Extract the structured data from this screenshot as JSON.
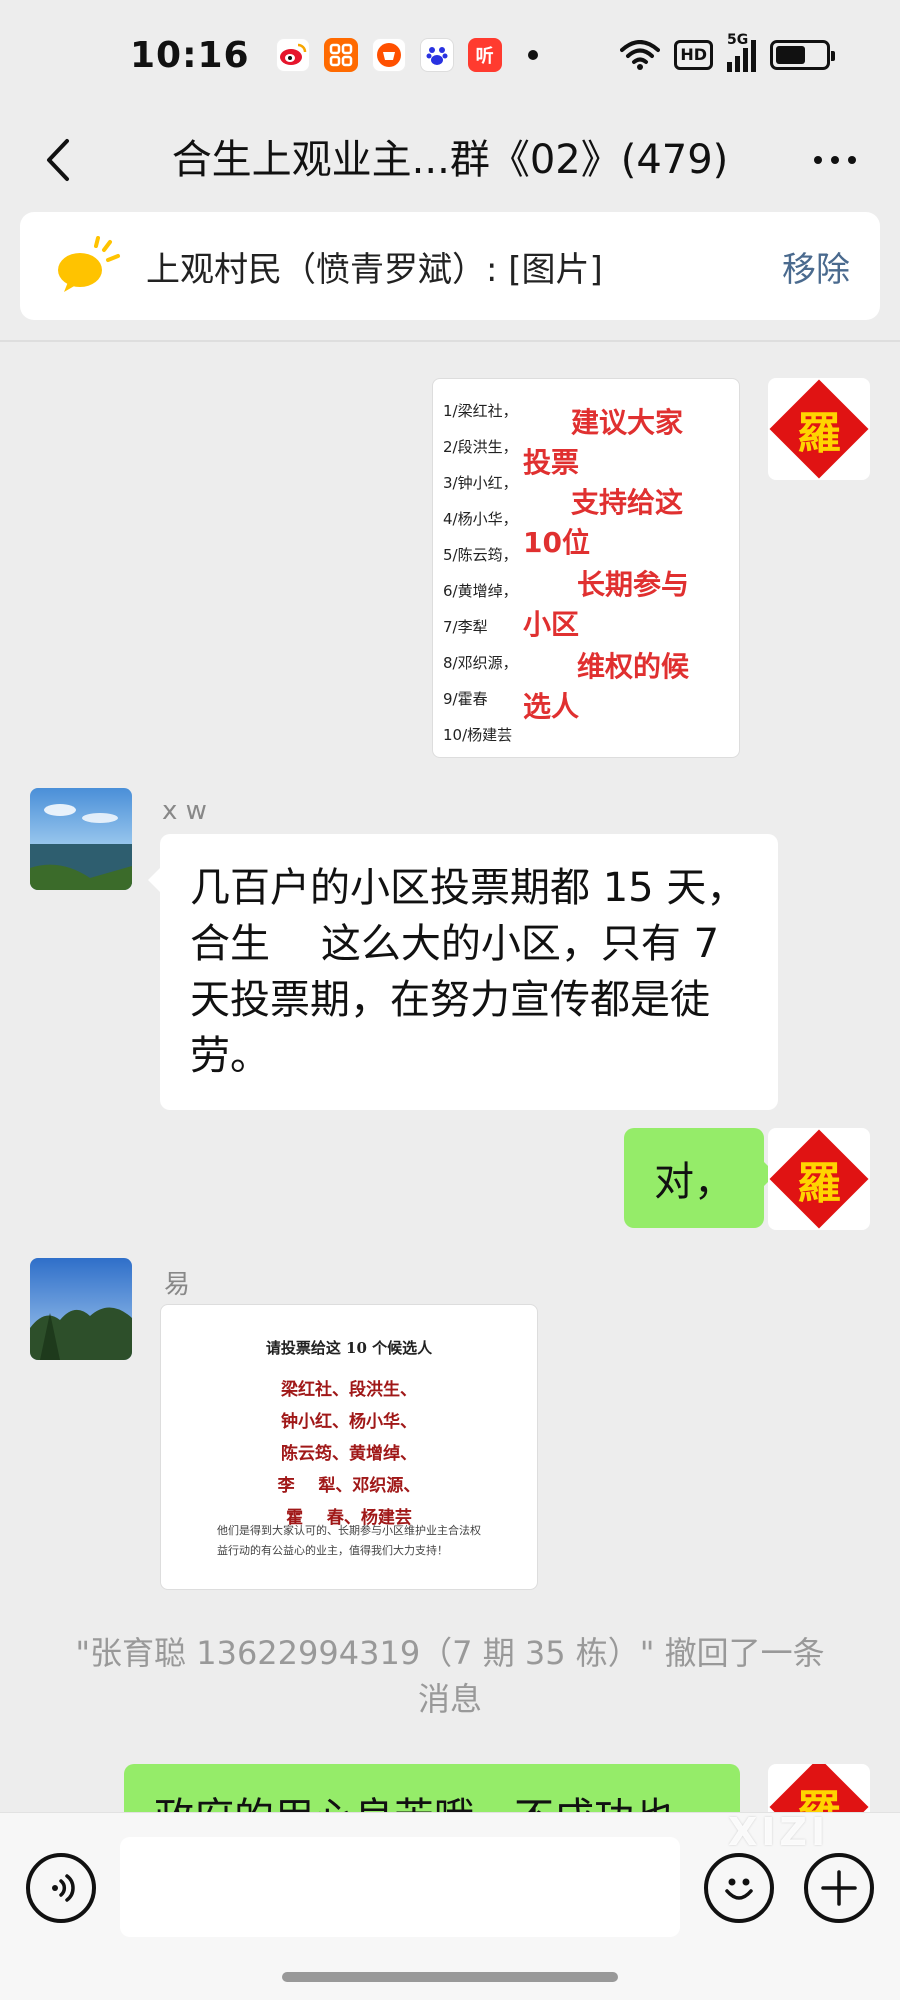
{
  "status_bar": {
    "time": "10:16",
    "hd": "HD",
    "network": "5G",
    "app_icons": [
      "weibo-icon",
      "app-grid-icon",
      "taobao-icon",
      "baidu-icon",
      "ting-icon"
    ],
    "ting_label": "听"
  },
  "nav": {
    "title": "合生上观业主...群《02》(479)"
  },
  "pinned": {
    "text": "上观村民（愤青罗斌）: [图片]",
    "remove_label": "移除"
  },
  "messages": {
    "img1": {
      "list": [
        "1/梁红社，",
        "2/段洪生，",
        "3/钟小红，",
        "4/杨小华，",
        "5/陈云筠，",
        "6/黄增绰，",
        "7/李犁",
        "8/邓织源，",
        "9/霍春",
        "10/杨建芸"
      ],
      "red_text": [
        "建议大家",
        "投票",
        "支持给这",
        "10位",
        "长期参与",
        "小区",
        "维权的候",
        "选人"
      ]
    },
    "xw": {
      "name": "x  w",
      "text_lines": [
        "几百户的小区投票期都 15 天，",
        "合生    这么大的小区，只有 7",
        "天投票期，在努力宣传都是徒",
        "劳。"
      ]
    },
    "me1": {
      "text": "对，"
    },
    "yi": {
      "name": "易",
      "img_title": "请投票给这 10 个候选人",
      "img_lines": [
        "梁红社、段洪生、",
        "钟小红、杨小华、",
        "陈云筠、黄增绰、",
        "李    犁、邓织源、",
        "霍    春、杨建芸"
      ],
      "img_foot": "他们是得到大家认可的、长期参与小区维护业主合法权益行动的有公益心的业主，值得我们大力支持！"
    },
    "system_note": "\"张育聪 13622994319（7 期 35 栋）\" 撤回了一条消息",
    "me2": {
      "text": "政府的用心良苦哦，不成功也"
    }
  },
  "luo_char": "羅",
  "watermark": "XIZI",
  "colors": {
    "green_bubble": "#95ec69",
    "luo_red": "#e01313",
    "luo_gold": "#ffd400",
    "link_blue": "#4a6a8e"
  }
}
